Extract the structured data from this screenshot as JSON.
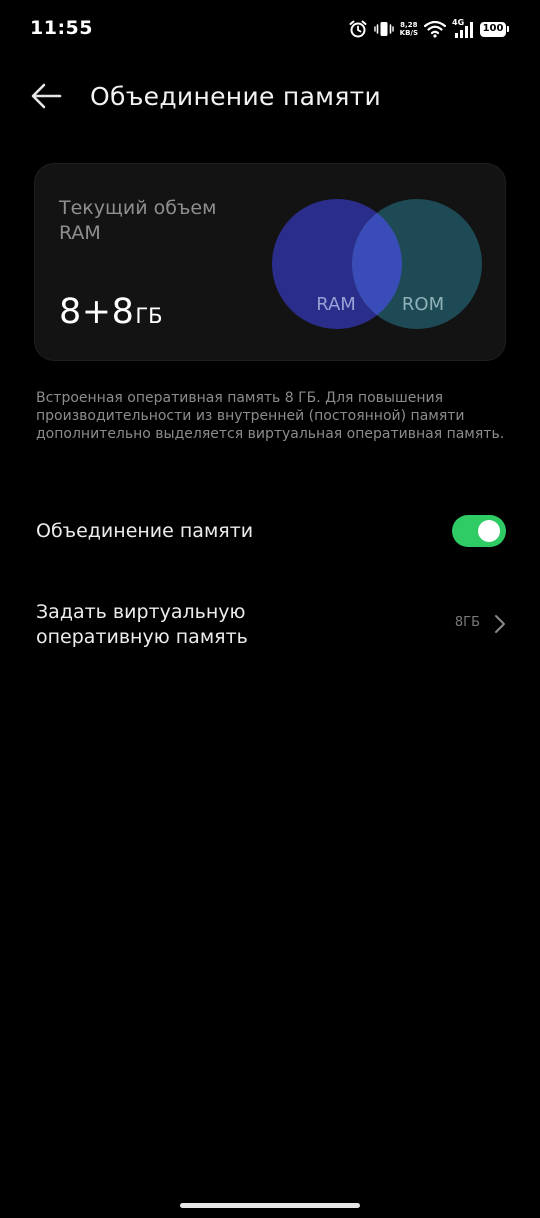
{
  "status_bar": {
    "time": "11:55",
    "net_speed_value": "8,28",
    "net_speed_unit": "KB/S",
    "network_type": "4G",
    "battery_level": "100",
    "icons": [
      "alarm-icon",
      "vibrate-icon",
      "wifi-icon",
      "signal-icon",
      "battery-icon"
    ]
  },
  "header": {
    "title": "Объединение памяти",
    "back_icon": "arrow-left-icon"
  },
  "ram_card": {
    "label": "Текущий объем RAM",
    "value": "8+8",
    "unit": "ГБ",
    "venn": {
      "left_label": "RAM",
      "right_label": "ROM",
      "left_color": "#2b2d8a",
      "right_color": "#1d4a55",
      "overlap_color": "#3a4cb8"
    }
  },
  "description": "Встроенная оперативная память 8 ГБ. Для повышения производительности из внутренней (постоянной) памяти дополнительно выделяется виртуальная оперативная память.",
  "settings": {
    "merge": {
      "label": "Объединение памяти",
      "enabled": true,
      "toggle_color": "#2fcc66"
    },
    "virtual": {
      "label": "Задать виртуальную оперативную память",
      "value": "8ГБ",
      "icon": "chevron-right-icon"
    }
  }
}
